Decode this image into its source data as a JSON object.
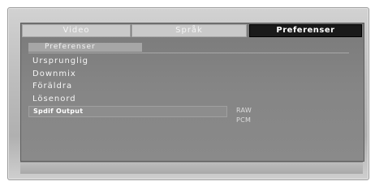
{
  "tabs": [
    {
      "label": "Video",
      "active": false
    },
    {
      "label": "Språk",
      "active": false
    },
    {
      "label": "Preferenser",
      "active": true
    }
  ],
  "section": {
    "title": "Preferenser"
  },
  "menu": {
    "items": [
      {
        "label": "Ursprunglig"
      },
      {
        "label": "Downmix"
      },
      {
        "label": "Föräldra"
      },
      {
        "label": "Lösenord"
      },
      {
        "label": "Spdif Output",
        "selected": true
      }
    ]
  },
  "spdif_options": [
    "RAW",
    "PCM"
  ],
  "colors": {
    "panel": "#858585",
    "active_tab": "#1a1a1a",
    "inactive_tab": "#c9c9c9",
    "text": "#f5f5f5"
  }
}
